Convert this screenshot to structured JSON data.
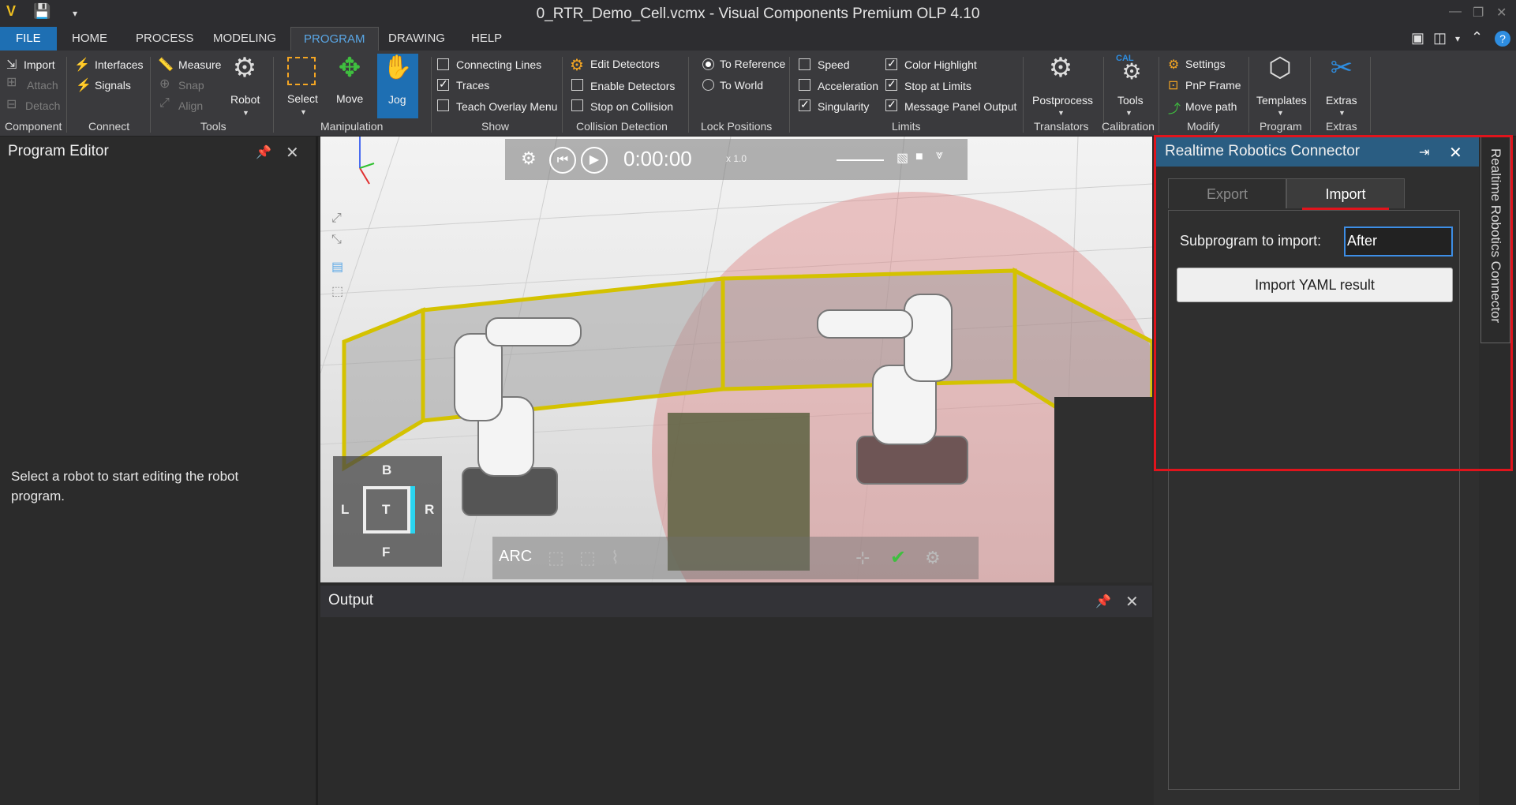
{
  "window": {
    "title": "0_RTR_Demo_Cell.vcmx - Visual Components Premium OLP 4.10"
  },
  "menu": {
    "file": "FILE",
    "home": "HOME",
    "process": "PROCESS",
    "modeling": "MODELING",
    "program": "PROGRAM",
    "drawing": "DRAWING",
    "help": "HELP"
  },
  "ribbon": {
    "component": {
      "import": "Import",
      "attach": "Attach",
      "detach": "Detach",
      "group": "Component"
    },
    "connect": {
      "interfaces": "Interfaces",
      "signals": "Signals",
      "group": "Connect"
    },
    "tools": {
      "measure": "Measure",
      "snap": "Snap",
      "align": "Align",
      "robot": "Robot",
      "group": "Tools"
    },
    "manipulation": {
      "select": "Select",
      "move": "Move",
      "jog": "Jog",
      "group": "Manipulation"
    },
    "show": {
      "connecting_lines": "Connecting Lines",
      "traces": "Traces",
      "teach_overlay": "Teach Overlay Menu",
      "group": "Show",
      "connecting_lines_checked": false,
      "traces_checked": true,
      "teach_overlay_checked": false
    },
    "collision": {
      "edit_detectors": "Edit Detectors",
      "enable_detectors": "Enable Detectors",
      "stop_on_collision": "Stop on Collision",
      "group": "Collision Detection",
      "enable_detectors_checked": false,
      "stop_on_collision_checked": false
    },
    "lock": {
      "to_reference": "To Reference",
      "to_world": "To World",
      "group": "Lock Positions",
      "selected": "to_reference"
    },
    "limits": {
      "speed": "Speed",
      "acceleration": "Acceleration",
      "singularity": "Singularity",
      "color_highlight": "Color Highlight",
      "stop_at_limits": "Stop at Limits",
      "message_panel_output": "Message Panel Output",
      "group": "Limits",
      "speed_checked": false,
      "acceleration_checked": false,
      "singularity_checked": true,
      "color_highlight_checked": true,
      "stop_at_limits_checked": true,
      "message_panel_output_checked": true
    },
    "translators": {
      "postprocess": "Postprocess",
      "group": "Translators"
    },
    "calibration": {
      "tools": "Tools",
      "cal_badge": "CAL",
      "group": "Calibration"
    },
    "modify": {
      "settings": "Settings",
      "pnp_frame": "PnP Frame",
      "move_path": "Move path",
      "group": "Modify"
    },
    "program": {
      "templates": "Templates",
      "group": "Program"
    },
    "extras": {
      "extras": "Extras",
      "group": "Extras"
    }
  },
  "program_editor": {
    "title": "Program Editor",
    "message": "Select a robot to start editing the robot program."
  },
  "viewport": {
    "time": "0:00:00",
    "speed": "x 1.0",
    "arc": "ARC",
    "navcube": {
      "top": "B",
      "left": "L",
      "center": "T",
      "right": "R",
      "bottom": "F"
    }
  },
  "output": {
    "title": "Output"
  },
  "rtr_panel": {
    "title": "Realtime Robotics Connector",
    "tab_export": "Export",
    "tab_import": "Import",
    "subprogram_label": "Subprogram to import:",
    "subprogram_value": "After",
    "import_button": "Import YAML result",
    "side_tab": "Realtime Robotics Connector"
  },
  "colors": {
    "accent_blue": "#1e6fb3",
    "panel_header": "#2a5d82",
    "highlight_red": "#e0141c",
    "jog_active": "#1e6fb3"
  }
}
